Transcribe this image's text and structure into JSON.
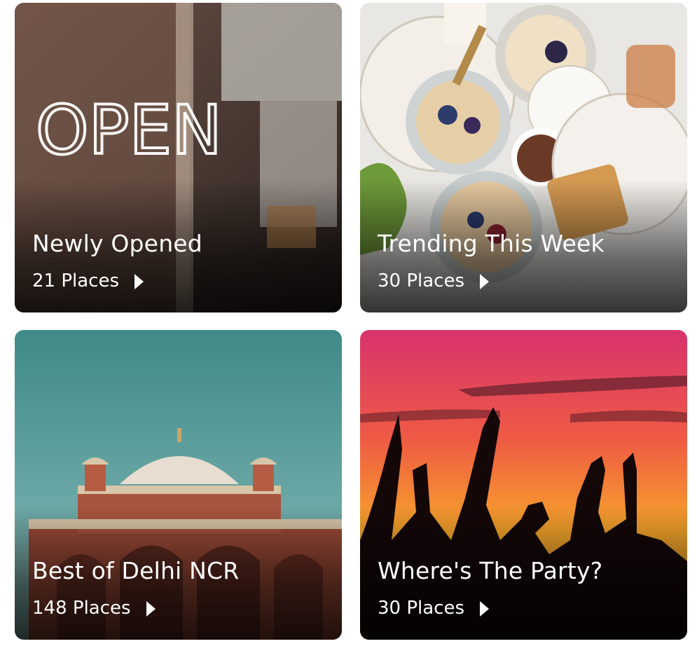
{
  "collections": [
    {
      "title": "Newly Opened",
      "places": "21 Places"
    },
    {
      "title": "Trending This Week",
      "places": "30 Places"
    },
    {
      "title": "Best of Delhi NCR",
      "places": "148 Places"
    },
    {
      "title": "Where's The Party?",
      "places": "30 Places"
    }
  ],
  "icons": {
    "arrow": "caret-right-icon"
  },
  "colors": {
    "text": "#ffffff",
    "background": "#ffffff"
  }
}
